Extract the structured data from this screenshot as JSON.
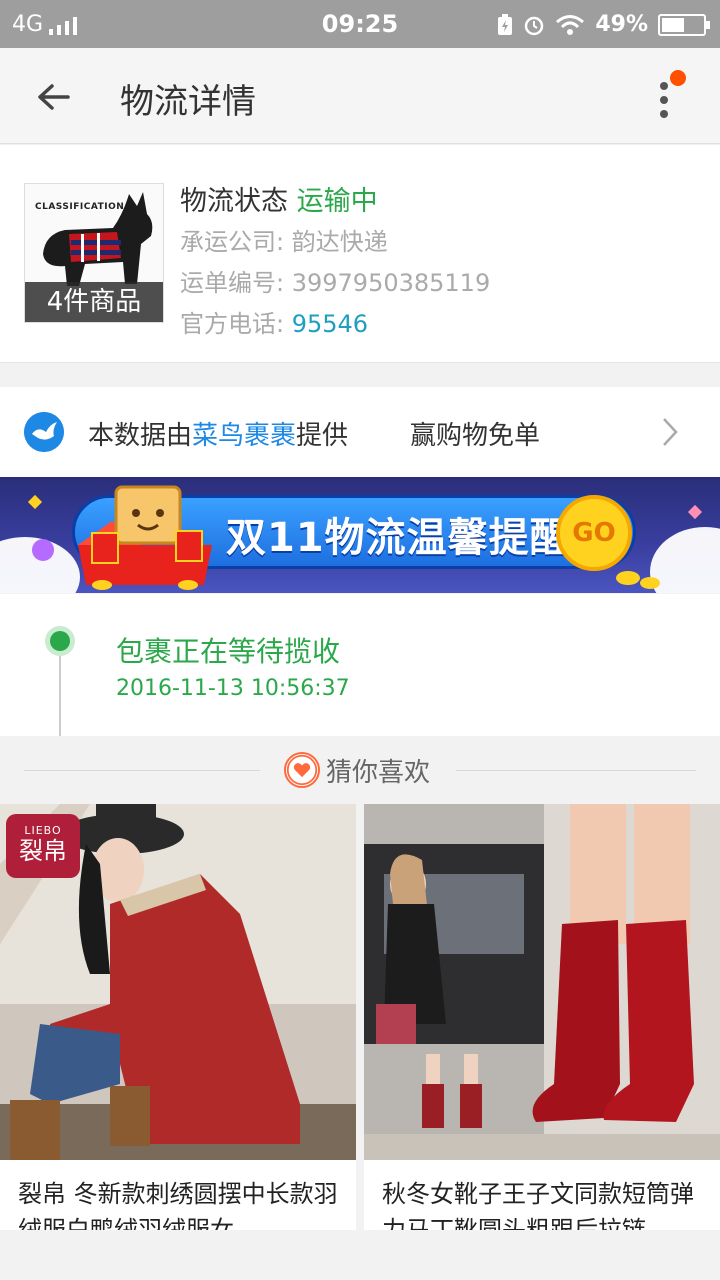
{
  "status_bar": {
    "network": "4G",
    "time": "09:25",
    "battery_percent": "49%",
    "battery_level": 0.49
  },
  "header": {
    "title": "物流详情"
  },
  "logistics": {
    "thumb_caption": "4件商品",
    "thumb_brand": "CLASSIFICATION",
    "status_label": "物流状态",
    "status_value": "运输中",
    "carrier_label": "承运公司: ",
    "carrier_value": "韵达快递",
    "tracking_label": "运单编号: ",
    "tracking_value": "3997950385119",
    "phone_label": "官方电话: ",
    "phone_value": "95546"
  },
  "provider": {
    "prefix": "本数据由",
    "highlight": "菜鸟裹裹",
    "suffix": "提供",
    "promo": "赢购物免单"
  },
  "banner": {
    "text": "双11物流温馨提醒",
    "go": "GO"
  },
  "timeline": {
    "event": "包裹正在等待揽收",
    "time": "2016-11-13 10:56:37"
  },
  "guess": {
    "label": "猜你喜欢"
  },
  "products": [
    {
      "name": "裂帛 冬新款刺绣圆摆中长款羽绒服白鸭绒羽绒服女",
      "brand_logo": "LIEBO 裂帛"
    },
    {
      "name": "秋冬女靴子王子文同款短筒弹力马丁靴圆头粗跟后拉链"
    }
  ],
  "colors": {
    "accent_green": "#2aa84a",
    "link_blue": "#1e88e5",
    "phone_blue": "#1f9fc0",
    "badge_orange": "#ff5000"
  }
}
